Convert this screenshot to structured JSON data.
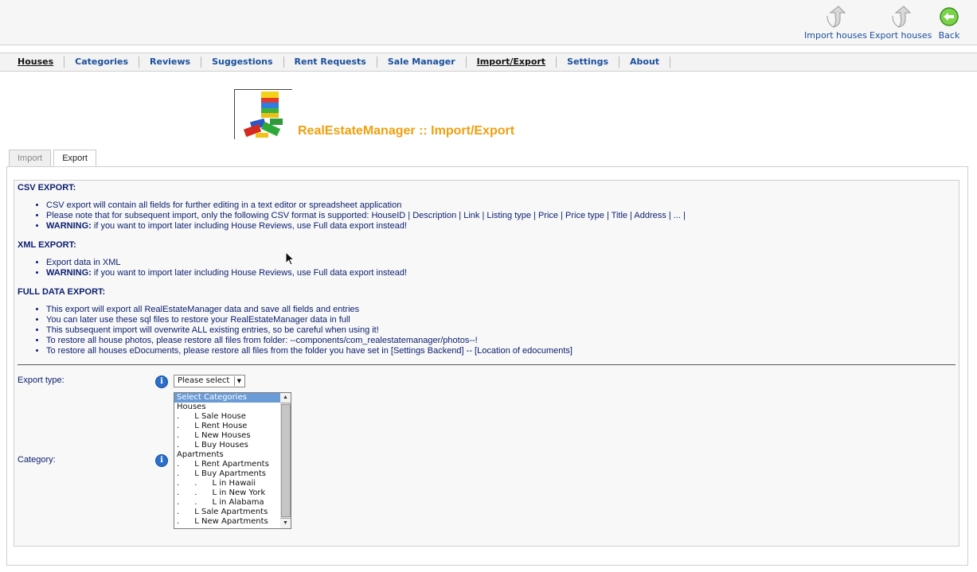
{
  "toolbar": {
    "import_label": "Import houses",
    "export_label": "Export houses",
    "back_label": "Back"
  },
  "menu": {
    "items": [
      "Houses",
      "Categories",
      "Reviews",
      "Suggestions",
      "Rent Requests",
      "Sale Manager",
      "Import/Export",
      "Settings",
      "About"
    ]
  },
  "header": {
    "title": "RealEstateManager :: Import/Export"
  },
  "tabs": [
    "Import",
    "Export"
  ],
  "csv": {
    "heading": "CSV EXPORT:",
    "item1": "CSV export will contain all fields for further editing in a text editor or spreadsheet application",
    "item2": "Please note that for subsequent import, only the following CSV format is supported:  HouseID | Description | Link | Listing type | Price | Price type | Title | Address | ... |",
    "warning_label": "WARNING:",
    "warning_text": " if you want to import later including House Reviews, use Full data export instead!"
  },
  "xml": {
    "heading": "XML EXPORT:",
    "item1": "Export data in XML",
    "warning_label": "WARNING:",
    "warning_text": " if you want to import later including House Reviews, use Full data export instead!"
  },
  "full": {
    "heading": "FULL DATA EXPORT:",
    "item1": "This export will export all RealEstateManager data and save all fields and entries",
    "item2": "You can later use these sql files to restore your RealEstateManager data in full",
    "item3": "This subsequent import will overwrite ALL existing entries, so be careful when using it!",
    "item4": "To restore all house photos, please restore all files from folder: --components/com_realestatemanager/photos--!",
    "item5": "To restore all houses eDocuments, please restore all files from the folder you have set in [Settings Backend] -- [Location of edocuments]"
  },
  "form": {
    "export_type_label": "Export type:",
    "export_type_value": "Please select",
    "category_label": "Category:",
    "info_glyph": "i",
    "categories": [
      "Select Categories",
      "Houses",
      ".      L Sale House",
      ".      L Rent House",
      ".      L New Houses",
      ".      L Buy Houses",
      "Apartments",
      ".      L Rent Apartments",
      ".      L Buy Apartments",
      ".      .      L in Hawaii",
      ".      .      L in New York",
      ".      .      L in Alabama",
      ".      L Sale Apartments",
      ".      L New Apartments"
    ],
    "selected_index": 0
  }
}
